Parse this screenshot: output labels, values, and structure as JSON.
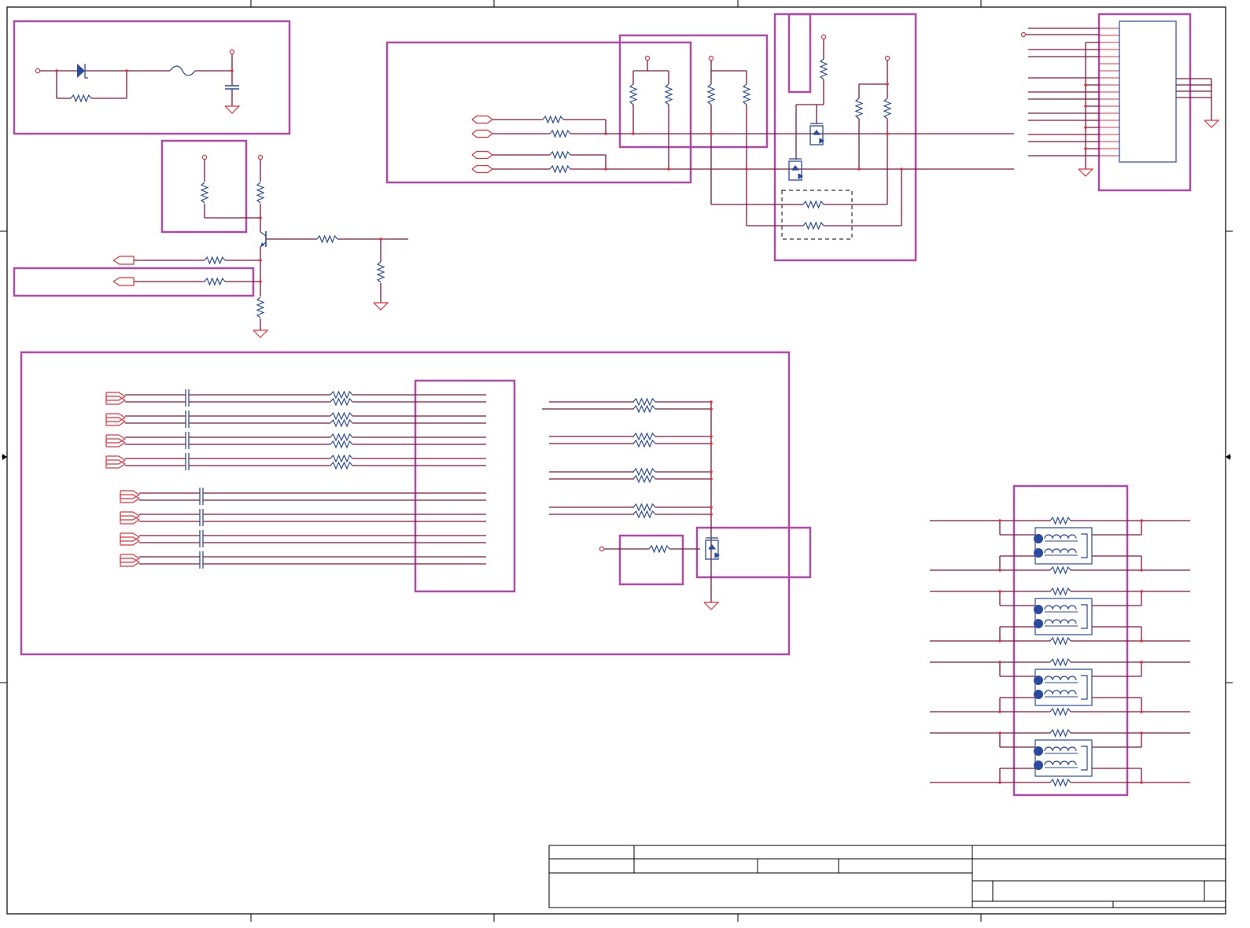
{
  "colors": {
    "border": "#000000",
    "wire": "#8a1538",
    "net_port": "#e8303a",
    "component": "#2a4aa0",
    "block": "#b04aa8",
    "background": "#ffffff"
  },
  "icons": [
    "resistor-icon",
    "capacitor-icon",
    "diode-icon",
    "fuse-icon",
    "ground-icon",
    "power-pin-icon",
    "transistor-icon",
    "mosfet-icon",
    "port-arrow-icon",
    "transformer-icon",
    "connector-icon"
  ]
}
